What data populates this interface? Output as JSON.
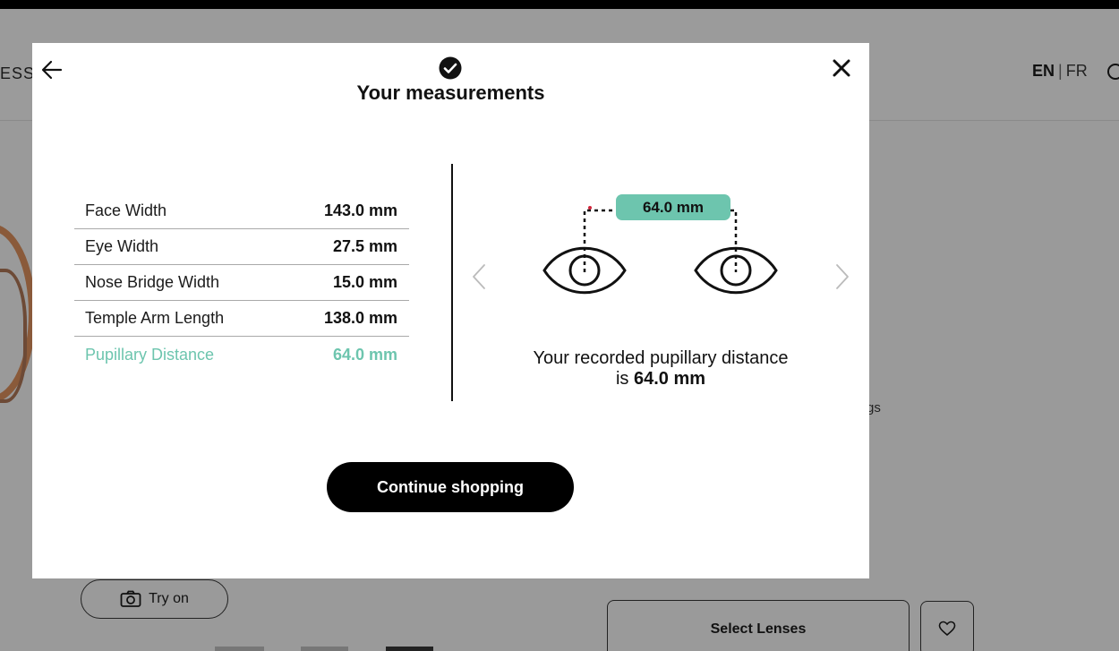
{
  "background": {
    "nav_fragment": "ESSIT",
    "lang_en": "EN",
    "lang_sep": "|",
    "lang_fr": "FR",
    "tag_fragment": "gs",
    "try_on_label": "Try on",
    "select_lenses_label": "Select Lenses"
  },
  "modal": {
    "title": "Your measurements",
    "measurements": [
      {
        "label": "Face Width",
        "value": "143.0 mm"
      },
      {
        "label": "Eye Width",
        "value": "27.5 mm"
      },
      {
        "label": "Nose Bridge Width",
        "value": "15.0 mm"
      },
      {
        "label": "Temple Arm Length",
        "value": "138.0 mm"
      },
      {
        "label": "Pupillary Distance",
        "value": "64.0 mm"
      }
    ],
    "pd_badge": "64.0 mm",
    "pd_text_prefix": "Your recorded pupillary distance",
    "pd_text_is": "is",
    "pd_text_value": "64.0 mm",
    "continue_label": "Continue shopping"
  },
  "colors": {
    "accent": "#6dc5ae",
    "overlay": "#9a9a9a"
  },
  "icons": {
    "back": "arrow-left-icon",
    "close": "close-icon",
    "check": "check-circle-icon",
    "prev": "chevron-left-icon",
    "next": "chevron-right-icon",
    "camera": "camera-icon",
    "heart": "heart-icon",
    "search": "search-icon"
  }
}
